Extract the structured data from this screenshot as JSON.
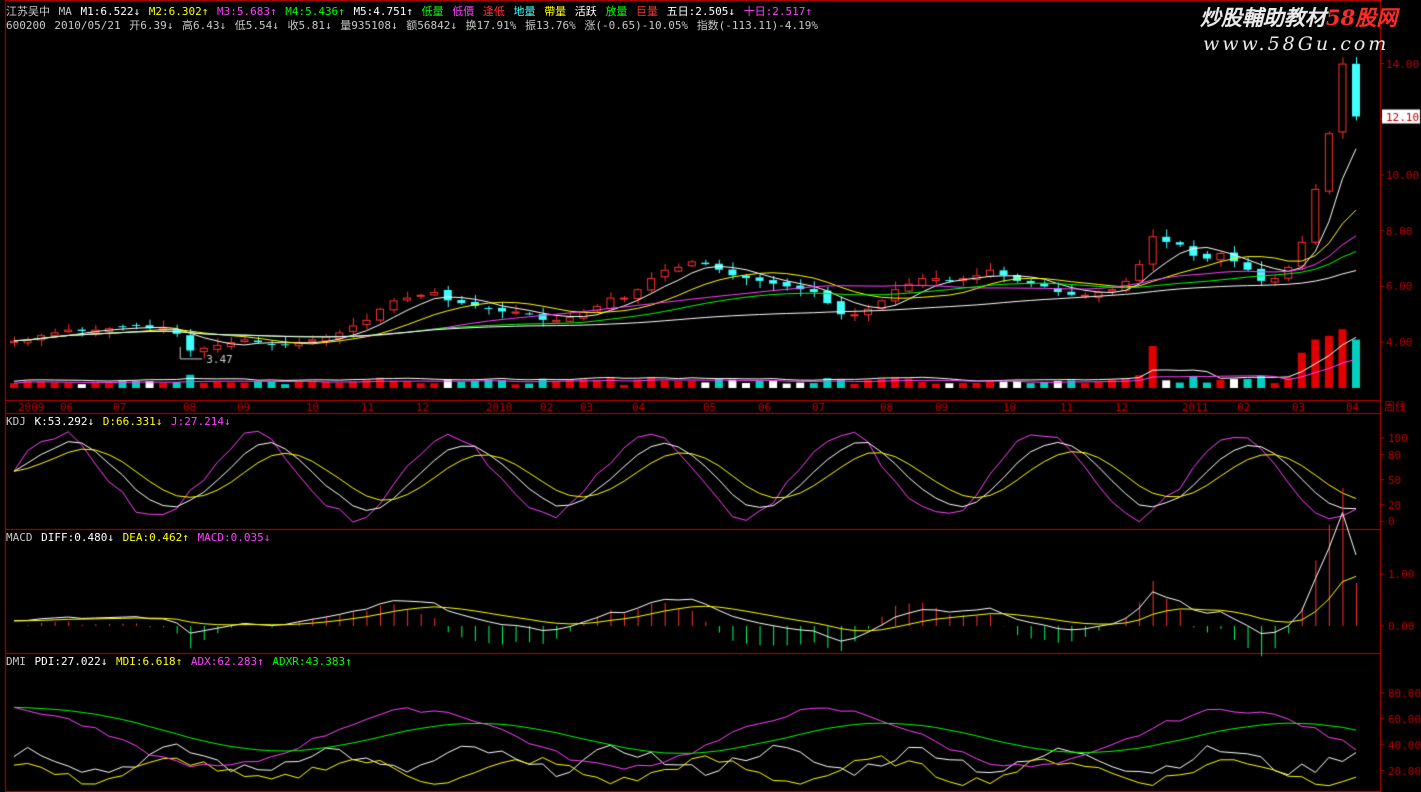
{
  "header": {
    "name": "江苏吴中",
    "ma_label": "MA",
    "m1": "M1:6.522↓",
    "m2": "M2:6.302↑",
    "m3": "M3:5.683↑",
    "m4": "M4:5.436↑",
    "m5": "M5:4.751↑",
    "low_vol": "低量",
    "low_price": "低價",
    "stop_fall": "逢低",
    "ground_vol": "地量",
    "tape_vol": "帶量",
    "active": "活跃",
    "heavy_vol": "放量",
    "huge_vol": "巨量",
    "five_day": "五日:2.505↓",
    "ten_day": "十日:2.517↑",
    "colors": {
      "name": "#c8c8c8",
      "m1": "#ffffff",
      "m2": "#ffff00",
      "m3": "#ff40ff",
      "m4": "#00ff00",
      "m5": "#ffffff",
      "tag_green": "#00ff00",
      "tag_red": "#ff3030",
      "tag_cyan": "#40ffff"
    }
  },
  "quote": {
    "code": "600200",
    "date": "2010/05/21",
    "open": "开6.39↓",
    "high": "高6.43↓",
    "low": "低5.54↓",
    "close": "收5.81↓",
    "volume": "量935108↓",
    "amount": "额56842↓",
    "turnover": "换17.91%",
    "amplitude": "振13.76%",
    "change": "涨(-0.65)-10.05%",
    "index": "指数(-113.11)-4.19%"
  },
  "watermark": {
    "line1_a": "炒股輔助教材",
    "line1_b": "58股网",
    "line2": "www.58Gu.com"
  },
  "chart_data": [
    {
      "type": "candlestick",
      "panel": "price",
      "y_ticks": [
        4.0,
        6.0,
        8.0,
        10.0,
        12.0,
        14.0
      ],
      "ylim": [
        3.0,
        14.2
      ],
      "current_price": "12.10",
      "low_marker": "3.47",
      "x_labels": [
        "2009",
        "06",
        "07",
        "08",
        "09",
        "10",
        "11",
        "12",
        "2010",
        "02",
        "03",
        "04",
        "05",
        "06",
        "07",
        "08",
        "09",
        "10",
        "11",
        "12",
        "2011",
        "02",
        "03",
        "04"
      ],
      "x_label_end": "周线",
      "weeks": 100,
      "closes": [
        4.05,
        4.1,
        4.25,
        4.35,
        4.45,
        4.4,
        4.45,
        4.5,
        4.55,
        4.6,
        4.5,
        4.5,
        4.3,
        3.7,
        3.8,
        3.9,
        4.0,
        4.1,
        4.0,
        3.9,
        3.9,
        4.0,
        4.1,
        4.2,
        4.35,
        4.6,
        4.8,
        5.2,
        5.5,
        5.6,
        5.7,
        5.8,
        5.5,
        5.4,
        5.3,
        5.2,
        5.1,
        5.1,
        5.0,
        4.8,
        4.8,
        4.9,
        5.1,
        5.3,
        5.6,
        5.6,
        5.9,
        6.3,
        6.6,
        6.7,
        6.9,
        6.8,
        6.6,
        6.4,
        6.3,
        6.2,
        6.1,
        6.0,
        5.9,
        5.8,
        5.4,
        5.0,
        5.0,
        5.2,
        5.5,
        5.9,
        6.1,
        6.3,
        6.3,
        6.2,
        6.3,
        6.4,
        6.6,
        6.4,
        6.2,
        6.1,
        6.0,
        5.8,
        5.7,
        5.7,
        5.8,
        5.9,
        6.2,
        6.8,
        7.8,
        7.6,
        7.5,
        7.1,
        7.0,
        7.2,
        6.9,
        6.6,
        6.2,
        6.3,
        6.7,
        7.6,
        9.5,
        11.5,
        14.0,
        12.1
      ],
      "ma_lines": [
        {
          "name": "M1",
          "color": "#ffffff",
          "period": 5
        },
        {
          "name": "M2",
          "color": "#ffff00",
          "period": 10
        },
        {
          "name": "M3",
          "color": "#ff40ff",
          "period": 20
        },
        {
          "name": "M4",
          "color": "#00ff00",
          "period": 30
        },
        {
          "name": "M5",
          "color": "#ffffff",
          "period": 60
        }
      ],
      "up_color": "#ff3030",
      "down_color": "#40ffff"
    },
    {
      "type": "line",
      "panel": "kdj",
      "label": "KDJ",
      "k": "K:53.292↓",
      "d": "D:66.331↓",
      "j": "J:27.214↓",
      "y_ticks": [
        0,
        20,
        50,
        80,
        100
      ],
      "ylim": [
        -8,
        112
      ]
    },
    {
      "type": "bar",
      "panel": "macd",
      "label": "MACD",
      "diff": "DIFF:0.480↓",
      "dea": "DEA:0.462↑",
      "macd": "MACD:0.035↓",
      "y_ticks": [
        0.0,
        1.0
      ],
      "y_tick_labels": [
        "0.00",
        "1.00"
      ],
      "ylim": [
        -0.5,
        1.6
      ]
    },
    {
      "type": "line",
      "panel": "dmi",
      "label": "DMI",
      "pdi": "PDI:27.022↓",
      "mdi": "MDI:6.618↑",
      "adx": "ADX:62.283↑",
      "adxr": "ADXR:43.383↑",
      "y_ticks": [
        20,
        40,
        60,
        80
      ],
      "y_tick_labels": [
        "20.00",
        "40.00",
        "60.00",
        "80.00"
      ],
      "ylim": [
        5,
        100
      ]
    }
  ]
}
